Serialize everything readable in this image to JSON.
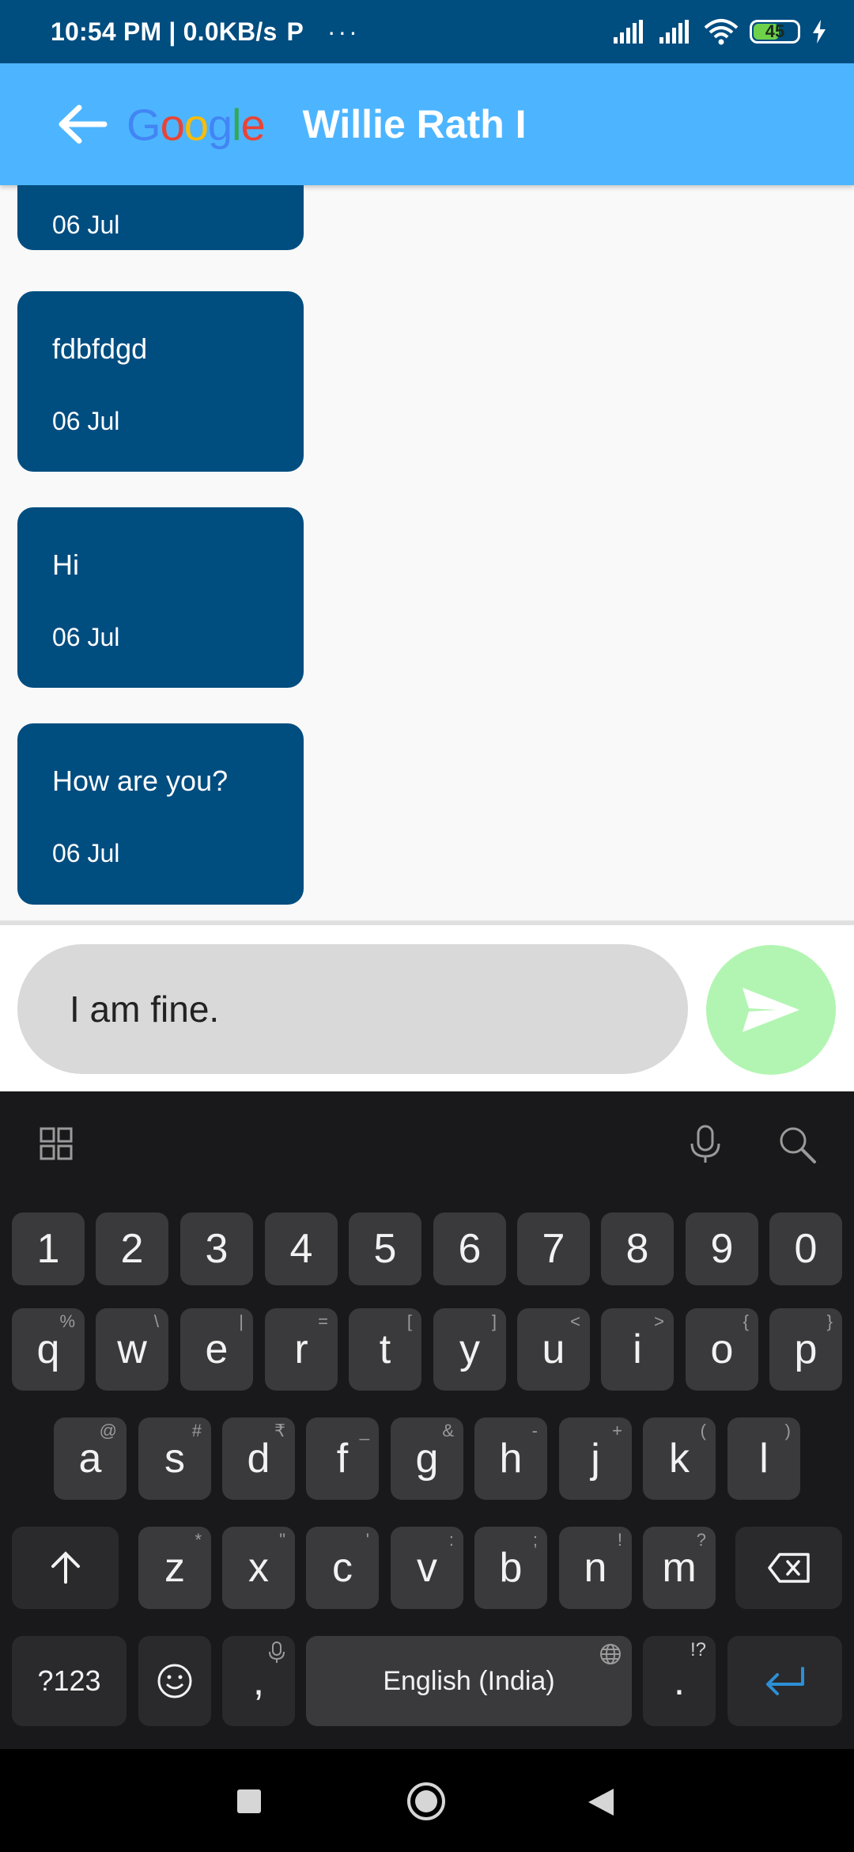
{
  "status_bar": {
    "time_info": "10:54 PM | 0.0KB/s",
    "app_indicator": "P",
    "more": "···",
    "battery": "45"
  },
  "app_bar": {
    "logo_text": "Google",
    "title": "Willie Rath I"
  },
  "messages": [
    {
      "text": "",
      "date": "06 Jul"
    },
    {
      "text": "fdbfdgd",
      "date": "06 Jul"
    },
    {
      "text": "Hi",
      "date": "06 Jul"
    },
    {
      "text": "How are you?",
      "date": "06 Jul"
    }
  ],
  "composer": {
    "value": "I am fine."
  },
  "keyboard": {
    "number_row": [
      "1",
      "2",
      "3",
      "4",
      "5",
      "6",
      "7",
      "8",
      "9",
      "0"
    ],
    "row1": [
      {
        "k": "q",
        "s": "%"
      },
      {
        "k": "w",
        "s": "\\"
      },
      {
        "k": "e",
        "s": "|"
      },
      {
        "k": "r",
        "s": "="
      },
      {
        "k": "t",
        "s": "["
      },
      {
        "k": "y",
        "s": "]"
      },
      {
        "k": "u",
        "s": "<"
      },
      {
        "k": "i",
        "s": ">"
      },
      {
        "k": "o",
        "s": "{"
      },
      {
        "k": "p",
        "s": "}"
      }
    ],
    "row2": [
      {
        "k": "a",
        "s": "@"
      },
      {
        "k": "s",
        "s": "#"
      },
      {
        "k": "d",
        "s": "₹"
      },
      {
        "k": "f",
        "s": "_"
      },
      {
        "k": "g",
        "s": "&"
      },
      {
        "k": "h",
        "s": "-"
      },
      {
        "k": "j",
        "s": "+"
      },
      {
        "k": "k",
        "s": "("
      },
      {
        "k": "l",
        "s": ")"
      }
    ],
    "row3": [
      {
        "k": "z",
        "s": "*"
      },
      {
        "k": "x",
        "s": "\""
      },
      {
        "k": "c",
        "s": "'"
      },
      {
        "k": "v",
        "s": ":"
      },
      {
        "k": "b",
        "s": ";"
      },
      {
        "k": "n",
        "s": "!"
      },
      {
        "k": "m",
        "s": "?"
      }
    ],
    "symbols_key": "?123",
    "comma_key": ",",
    "space_label": "English (India)",
    "period_key": ".",
    "period_sub": "!?"
  },
  "colors": {
    "status_bar": "#004d80",
    "app_bar": "#4db5ff",
    "bubble": "#004d80",
    "send_button": "#b2f5b2"
  }
}
